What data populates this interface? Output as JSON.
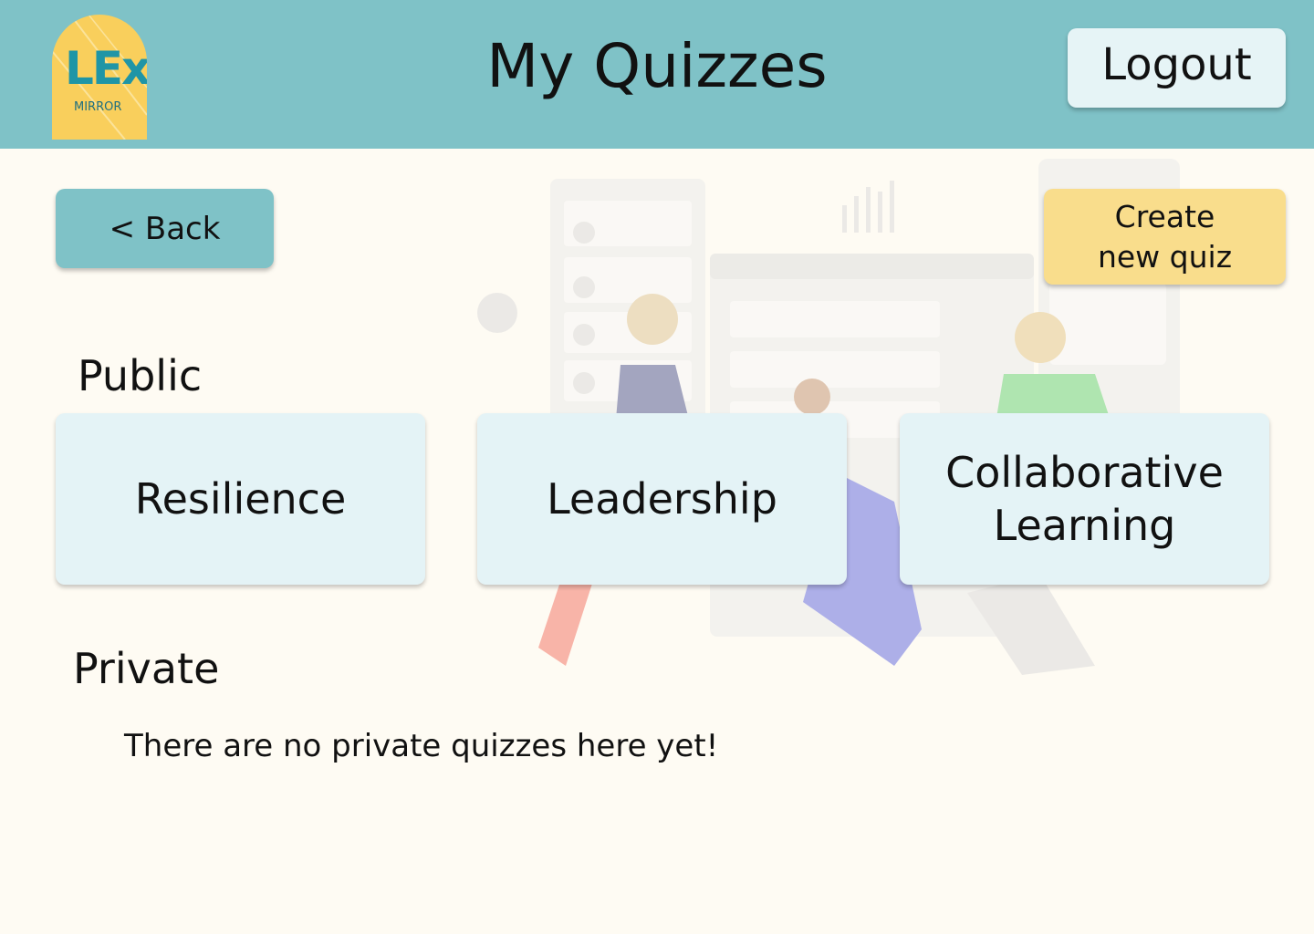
{
  "header": {
    "logo": {
      "main": "LEx",
      "sub": "MIRROR"
    },
    "title": "My Quizzes",
    "logout_label": "Logout"
  },
  "toolbar": {
    "back_label": "< Back",
    "create_label": "Create new quiz"
  },
  "sections": {
    "public": {
      "heading": "Public",
      "quizzes": [
        "Resilience",
        "Leadership",
        "Collaborative Learning"
      ]
    },
    "private": {
      "heading": "Private",
      "empty_message": "There are no private quizzes here yet!"
    }
  },
  "colors": {
    "header_bg": "#7fc2c7",
    "page_bg": "#fefbf3",
    "card_bg": "#e4f3f6",
    "create_bg": "#f9dd8c",
    "logo_bg": "#f9cf5c"
  }
}
